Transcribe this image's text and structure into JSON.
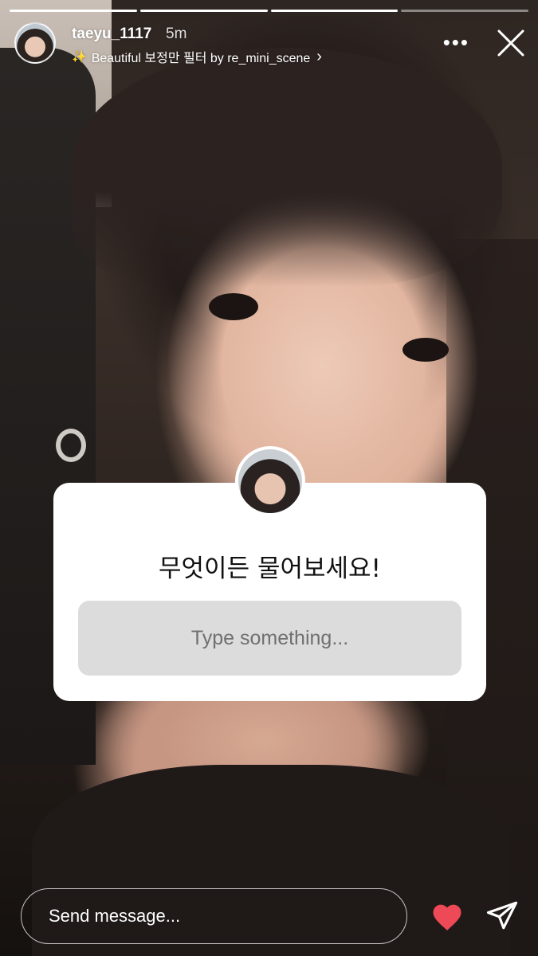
{
  "story": {
    "segments": [
      {
        "progress": 1.0
      },
      {
        "progress": 1.0
      },
      {
        "progress": 1.0
      },
      {
        "progress": 0.0
      }
    ],
    "username": "taeyu_1117",
    "time_ago": "5m",
    "filter_label": "Beautiful 보정만 필터 by re_mini_scene",
    "icons": {
      "filter": "sparkle-icon",
      "filter_chevron": "chevron-right-icon",
      "more": "more-icon",
      "close": "close-icon"
    }
  },
  "question_sticker": {
    "title": "무엇이든 물어보세요!",
    "placeholder": "Type something..."
  },
  "footer": {
    "message_placeholder": "Send message...",
    "like_icon": "heart-icon",
    "share_icon": "send-icon",
    "like_color": "#ed4956"
  }
}
